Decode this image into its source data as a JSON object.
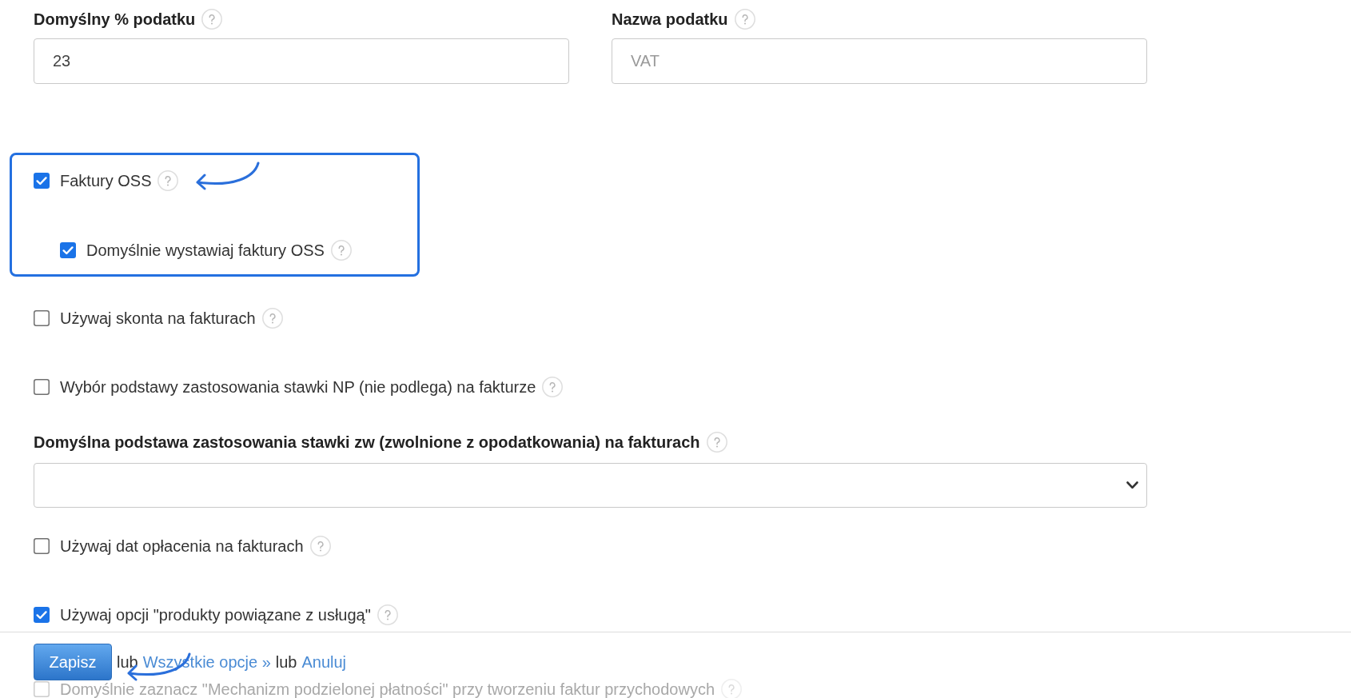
{
  "tax_fields": [
    {
      "label": "Domyślny % podatku",
      "value": "23"
    },
    {
      "label": "Nazwa podatku",
      "placeholder": "VAT"
    }
  ],
  "options": [
    {
      "kind": "checkbox",
      "label": "Faktury OSS",
      "checked": true,
      "highlighted": true,
      "children": [
        {
          "kind": "checkbox",
          "label": "Domyślnie wystawiaj faktury OSS",
          "checked": true
        }
      ]
    },
    {
      "kind": "checkbox",
      "label": "Używaj skonta na fakturach",
      "checked": false,
      "highlighted": false
    },
    {
      "kind": "checkbox",
      "label": "Wybór podstawy zastosowania stawki NP (nie podlega) na fakturze",
      "checked": false,
      "highlighted": false
    },
    {
      "kind": "select",
      "label": "Domyślna podstawa zastosowania stawki zw (zwolnione z opodatkowania) na fakturach"
    },
    {
      "kind": "checkbox",
      "label": "Używaj dat opłacenia na fakturach",
      "checked": false,
      "highlighted": false
    },
    {
      "kind": "checkbox",
      "label": "Używaj opcji \"produkty powiązane z usługą\"",
      "checked": true,
      "highlighted": false
    }
  ],
  "footer": {
    "save_button": "Zapisz",
    "parts": [
      {
        "kind": "text",
        "text": "lub"
      },
      {
        "kind": "link",
        "text": "Wszystkie opcje »"
      },
      {
        "kind": "text",
        "text": "lub"
      },
      {
        "kind": "link",
        "text": "Anuluj"
      }
    ]
  },
  "covered_option": {
    "label": "Domyślnie zaznacz \"Mechanizm podzielonej płatności\" przy tworzeniu faktur przychodowych",
    "checked": false
  }
}
